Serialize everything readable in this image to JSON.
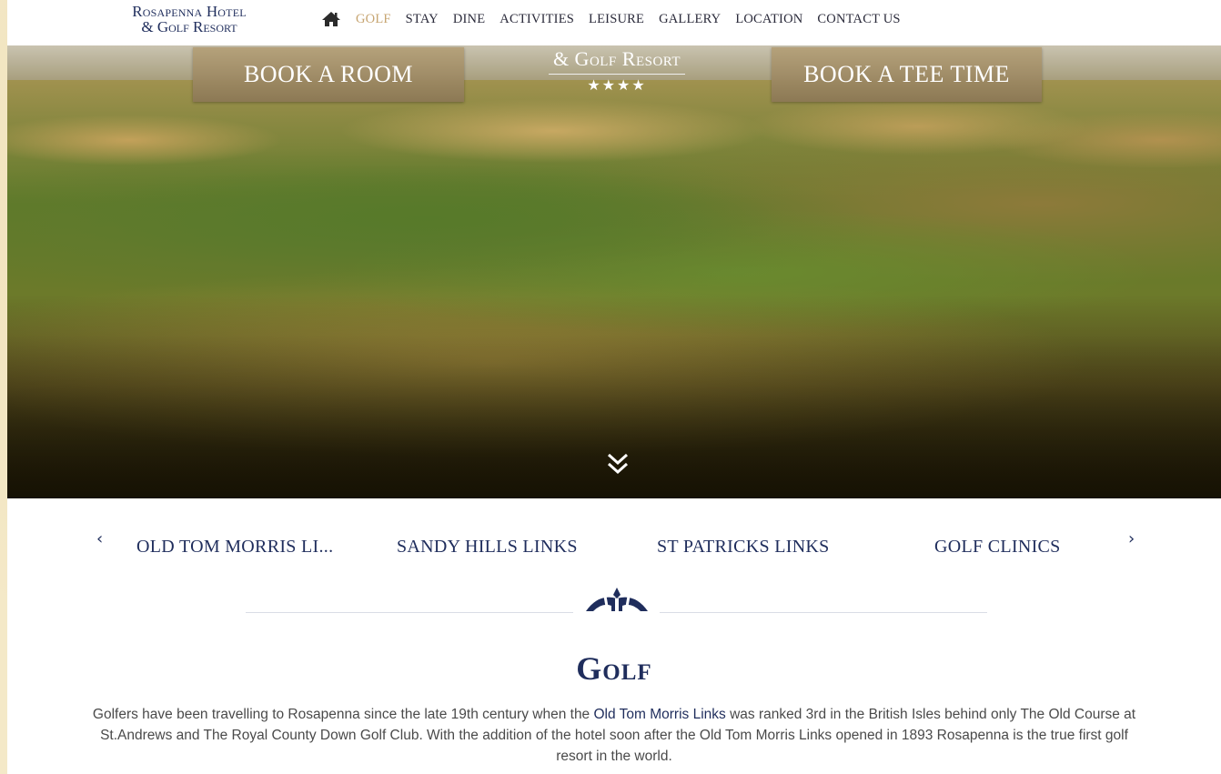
{
  "logo": {
    "line1": "Rosapenna Hotel",
    "line2": "& Golf Resort"
  },
  "nav": {
    "home_icon": "home-icon",
    "items": [
      "GOLF",
      "STAY",
      "DINE",
      "ACTIVITIES",
      "LEISURE",
      "GALLERY",
      "LOCATION",
      "CONTACT US"
    ],
    "active": "GOLF"
  },
  "hero": {
    "book_room": "BOOK A ROOM",
    "book_tee": "BOOK A TEE TIME",
    "resort_title": "& Golf Resort",
    "stars": "★★★★",
    "scroll_icon": "double-chevron-down-icon"
  },
  "carousel": {
    "prev_icon": "chevron-left-icon",
    "next_icon": "chevron-right-icon",
    "items": [
      "OLD TOM MORRIS LI...",
      "SANDY HILLS LINKS",
      "ST PATRICKS LINKS",
      "GOLF CLINICS"
    ]
  },
  "section": {
    "title": "Golf",
    "text_before": "Golfers have been travelling to Rosapenna since the late 19th century when the ",
    "link": "Old Tom Morris Links",
    "text_after": " was ranked 3rd in the British Isles behind only The Old Course at St.Andrews and The Royal County Down Golf Club. With the addition of the hotel soon after the Old Tom Morris Links opened in 1893 Rosapenna is the true first golf resort in the world."
  },
  "colors": {
    "navy": "#1f2d5c",
    "gold": "#c7a572",
    "parchment": "#f4e9c8"
  }
}
